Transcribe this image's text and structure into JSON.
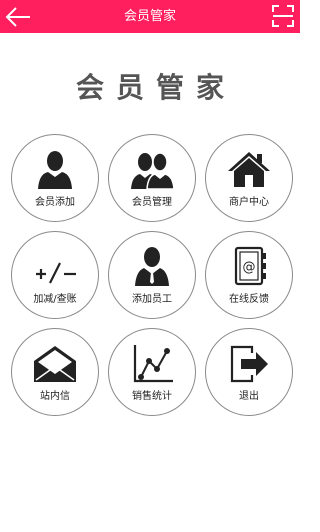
{
  "header": {
    "title": "会员管家",
    "accent_color": "#ff1f5e",
    "back_icon": "arrow-left-icon",
    "right_icon": "scan-icon"
  },
  "heading": "会员管家",
  "tiles": [
    {
      "label": "会员添加",
      "icon": "user-icon"
    },
    {
      "label": "会员管理",
      "icon": "users-icon"
    },
    {
      "label": "商户中心",
      "icon": "home-icon"
    },
    {
      "label": "加减/查账",
      "icon": "plus-minus-icon"
    },
    {
      "label": "添加员工",
      "icon": "employee-icon"
    },
    {
      "label": "在线反馈",
      "icon": "contact-book-icon"
    },
    {
      "label": "站内信",
      "icon": "envelope-icon"
    },
    {
      "label": "销售统计",
      "icon": "line-chart-icon"
    },
    {
      "label": "退出",
      "icon": "logout-icon"
    }
  ]
}
